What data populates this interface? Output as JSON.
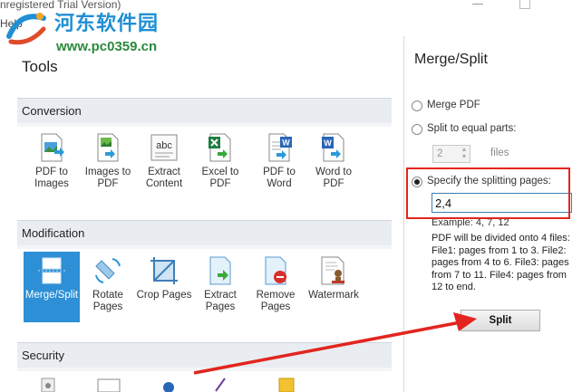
{
  "window": {
    "title": "nregistered Trial Version)",
    "menu_help": "Help"
  },
  "watermark": {
    "site_name": "河东软件园",
    "url": "www.pc0359.cn"
  },
  "tools": {
    "heading": "Tools",
    "sections": [
      {
        "name": "Conversion",
        "items": [
          {
            "label": "PDF to Images",
            "icon": "pdf-to-images-icon"
          },
          {
            "label": "Images to PDF",
            "icon": "images-to-pdf-icon"
          },
          {
            "label": "Extract Content",
            "icon": "extract-content-icon"
          },
          {
            "label": "Excel to PDF",
            "icon": "excel-to-pdf-icon"
          },
          {
            "label": "PDF to Word",
            "icon": "pdf-to-word-icon"
          },
          {
            "label": "Word to PDF",
            "icon": "word-to-pdf-icon"
          }
        ]
      },
      {
        "name": "Modification",
        "items": [
          {
            "label": "Merge/Split",
            "icon": "merge-split-icon",
            "selected": true
          },
          {
            "label": "Rotate Pages",
            "icon": "rotate-pages-icon"
          },
          {
            "label": "Crop Pages",
            "icon": "crop-pages-icon"
          },
          {
            "label": "Extract Pages",
            "icon": "extract-pages-icon"
          },
          {
            "label": "Remove Pages",
            "icon": "remove-pages-icon"
          },
          {
            "label": "Watermark",
            "icon": "watermark-icon"
          }
        ]
      },
      {
        "name": "Security",
        "items": []
      }
    ]
  },
  "merge_split": {
    "title": "Merge/Split",
    "options": {
      "merge": "Merge PDF",
      "split_equal": "Split to equal parts:",
      "split_specify": "Specify the splitting pages:"
    },
    "selected_option": "split_specify",
    "parts_value": "2",
    "parts_unit": "files",
    "pages_value": "2,4",
    "example": "Example: 4, 7, 12",
    "description": "PDF will be divided onto 4 files: File1: pages from 1 to 3. File2: pages from 4 to 6. File3: pages from 7 to 11. File4: pages from 12 to end.",
    "split_button": "Split"
  },
  "colors": {
    "accent": "#2d8fd5",
    "annotation_red": "#e3251f",
    "section_bg": "#e9edf1"
  }
}
